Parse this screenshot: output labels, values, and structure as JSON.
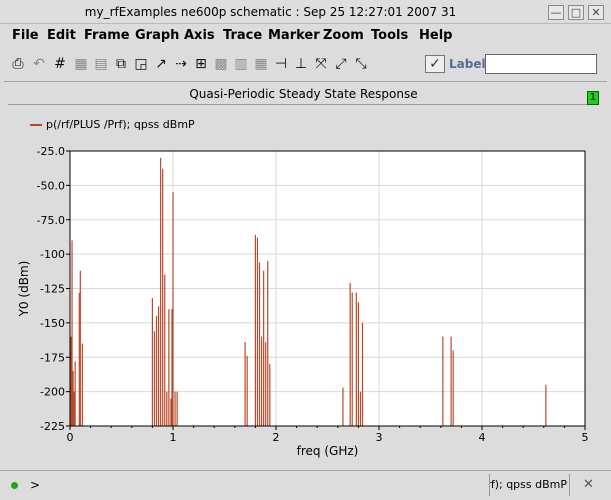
{
  "window": {
    "title": "my_rfExamples ne600p schematic : Sep 25 12:27:01 2007 31",
    "minimize_glyph": "—",
    "maximize_glyph": "□",
    "close_glyph": "✕"
  },
  "menubar": {
    "items": [
      "File",
      "Edit",
      "Frame",
      "Graph",
      "Axis",
      "Trace",
      "Marker",
      "Zoom",
      "Tools",
      "Help"
    ]
  },
  "toolbar": {
    "icons": [
      "print-icon",
      "undo-icon",
      "grid-icon",
      "strip-icon",
      "display-icon",
      "sub-window-icon",
      "new-window-icon",
      "move-icon",
      "copy-icon",
      "label-icon",
      "delete-icon",
      "hide-icon",
      "calculator-icon",
      "vertical-marker-icon",
      "horizontal-marker-icon",
      "zoom-fit-icon",
      "zoom-in-icon",
      "zoom-out-icon"
    ],
    "glyphs": [
      "⎙",
      "↶",
      "#",
      "▦",
      "▤",
      "⧉",
      "◲",
      "↗",
      "⇢",
      "⊞",
      "▩",
      "▥",
      "▦",
      "⊣",
      "⊥",
      "⤧",
      "⤢",
      "⤡"
    ],
    "label_check_glyph": "✓",
    "label_text": "Label",
    "label_value": ""
  },
  "plot": {
    "title": "Quasi-Periodic Steady State Response",
    "subwindow_badge": "1",
    "legend": "p(/rf/PLUS /Prf); qpss dBmP"
  },
  "colors": {
    "trace": "#b84a2a",
    "grid": "#d8d8d8",
    "badge": "#22cc22",
    "status_dot": "#1aaa1a"
  },
  "chart_data": {
    "type": "bar",
    "xlabel": "freq (GHz)",
    "ylabel": "Y0 (dBm)",
    "xlim": [
      0,
      5
    ],
    "ylim": [
      -225,
      -25
    ],
    "xticks": [
      "0",
      "1",
      "2",
      "3",
      "4",
      "5"
    ],
    "yticks": [
      "-25.0",
      "-50.0",
      "-75.0",
      "-100",
      "-125",
      "-150",
      "-175",
      "-200",
      "-225"
    ],
    "grid": true,
    "series": [
      {
        "name": "p(/rf/PLUS /Prf); qpss dBmP",
        "x": [
          0.01,
          0.02,
          0.03,
          0.04,
          0.05,
          0.09,
          0.1,
          0.12,
          0.8,
          0.82,
          0.84,
          0.86,
          0.88,
          0.9,
          0.92,
          0.94,
          0.96,
          0.98,
          0.99,
          1.0,
          1.02,
          1.04,
          1.7,
          1.72,
          1.8,
          1.82,
          1.84,
          1.86,
          1.88,
          1.9,
          1.92,
          1.94,
          2.65,
          2.72,
          2.74,
          2.78,
          2.8,
          2.82,
          2.84,
          3.62,
          3.7,
          3.72,
          4.62
        ],
        "values": [
          -160,
          -90,
          -185,
          -200,
          -178,
          -128,
          -112,
          -165,
          -132,
          -156,
          -145,
          -138,
          -30,
          -38,
          -115,
          -200,
          -140,
          -205,
          -140,
          -55,
          -200,
          -200,
          -164,
          -174,
          -86,
          -88,
          -106,
          -160,
          -112,
          -164,
          -105,
          -180,
          -197,
          -121,
          -128,
          -128,
          -135,
          -200,
          -150,
          -160,
          -160,
          -170,
          -195
        ]
      }
    ]
  },
  "status": {
    "prompt": ">",
    "line_text": "p(/rf/PLUS /Prf); qpss dBmP",
    "close_glyph": "✕"
  }
}
